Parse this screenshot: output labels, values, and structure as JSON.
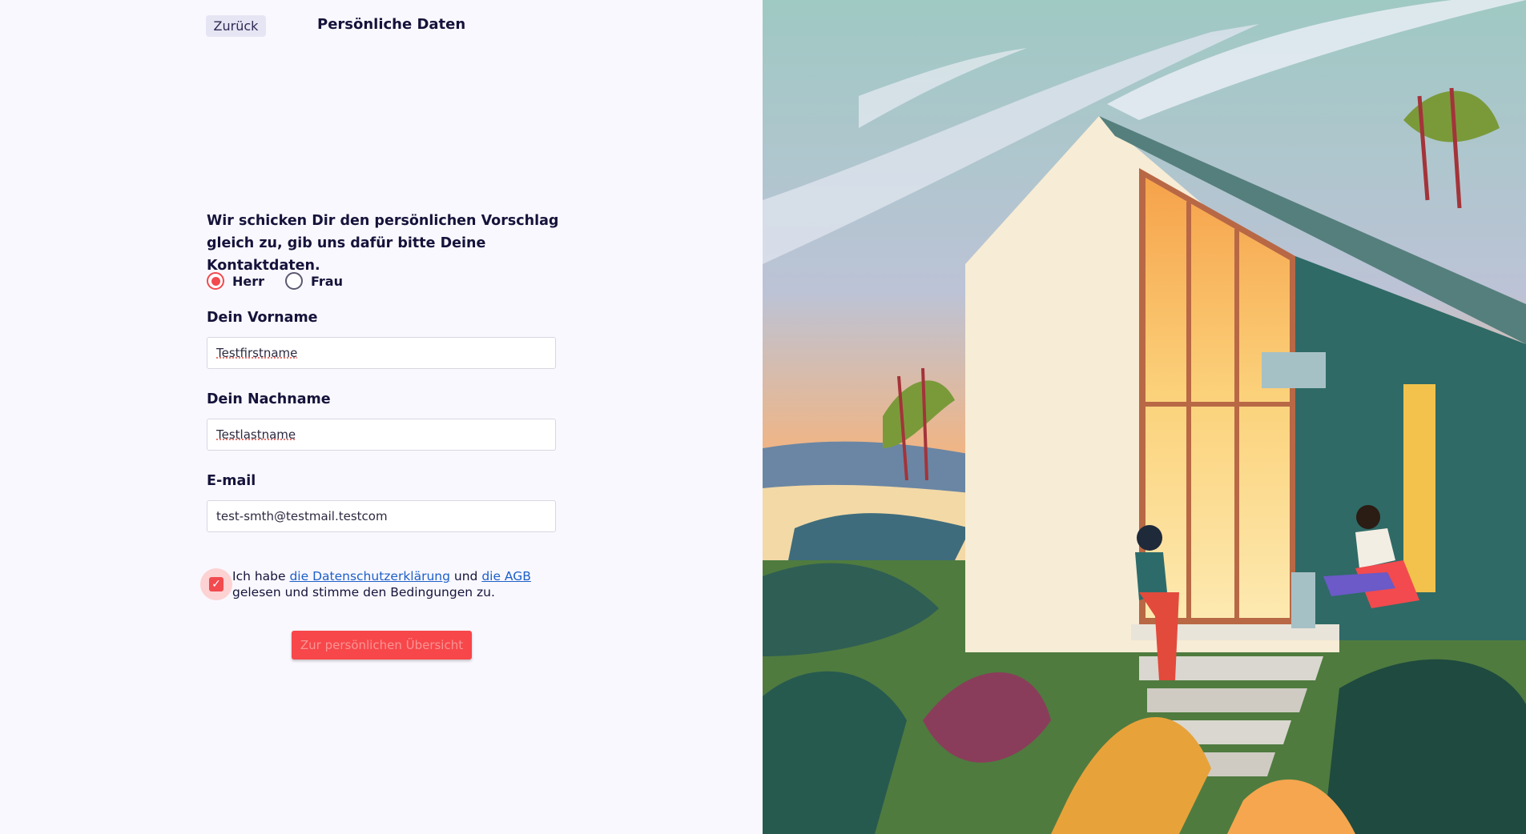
{
  "header": {
    "back_label": "Zurück",
    "title": "Persönliche Daten"
  },
  "form": {
    "intro": "Wir schicken Dir den persönlichen Vorschlag gleich zu, gib uns dafür bitte Deine Kontaktdaten.",
    "salutation": {
      "options": [
        {
          "label": "Herr",
          "checked": true
        },
        {
          "label": "Frau",
          "checked": false
        }
      ]
    },
    "firstname": {
      "label": "Dein Vorname",
      "value": "Testfirstname"
    },
    "lastname": {
      "label": "Dein Nachname",
      "value": "Testlastname"
    },
    "email": {
      "label": "E-mail",
      "value": "test-smth@testmail.testcom"
    },
    "consent": {
      "checked": true,
      "text_before": "Ich habe ",
      "link_privacy": "die Datenschutzerklärung",
      "text_middle": " und ",
      "link_terms": "die AGB",
      "text_after": "gelesen und stimme den Bedingungen zu."
    },
    "submit_label": "Zur persönlichen Übersicht"
  },
  "colors": {
    "accent": "#f24a4e",
    "link": "#1d5fc8",
    "background": "#f9f8fe",
    "text": "#15133a"
  },
  "illustration": {
    "icon": "tiny-house-illustration"
  }
}
